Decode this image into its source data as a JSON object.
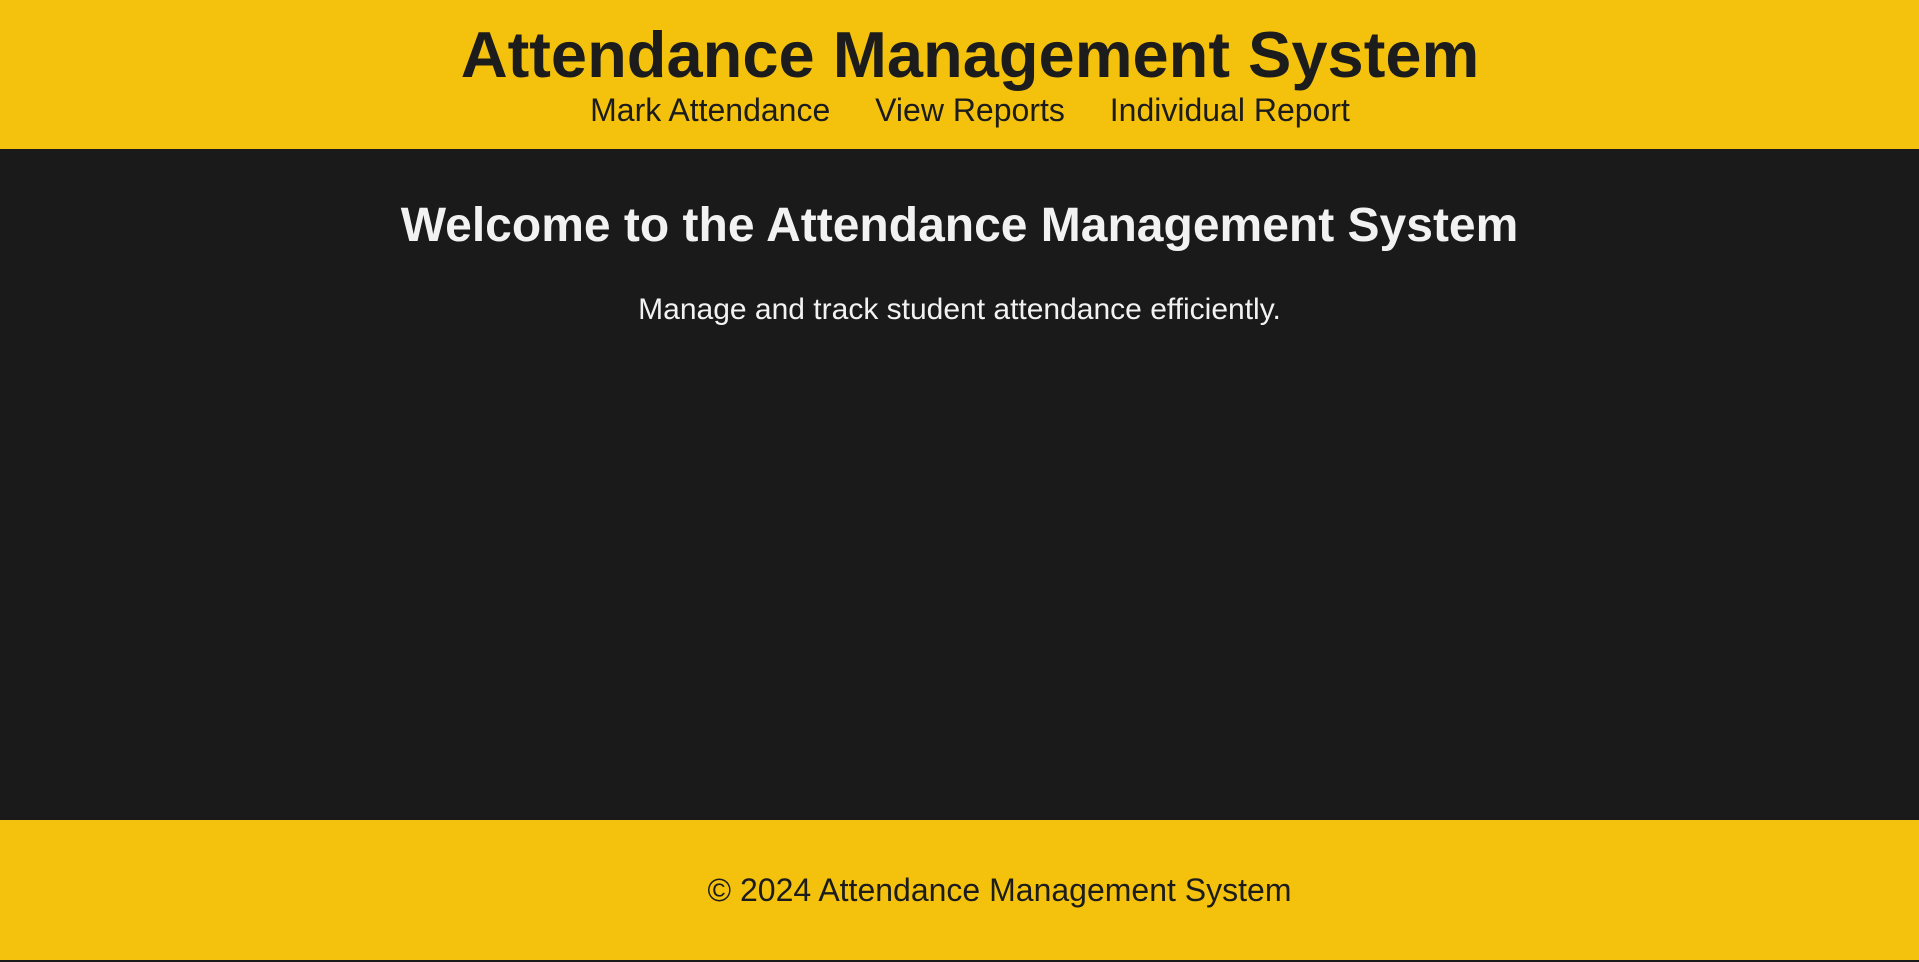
{
  "header": {
    "title": "Attendance Management System",
    "nav": [
      {
        "label": "Mark Attendance"
      },
      {
        "label": "View Reports"
      },
      {
        "label": "Individual Report"
      }
    ]
  },
  "main": {
    "heading": "Welcome to the Attendance Management System",
    "subtext": "Manage and track student attendance efficiently."
  },
  "footer": {
    "text": "© 2024 Attendance Management System"
  },
  "colors": {
    "accent": "#f4c20d",
    "background": "#1a1a1a",
    "header_text": "#1c1c1c",
    "body_text": "#f2f2f2"
  }
}
